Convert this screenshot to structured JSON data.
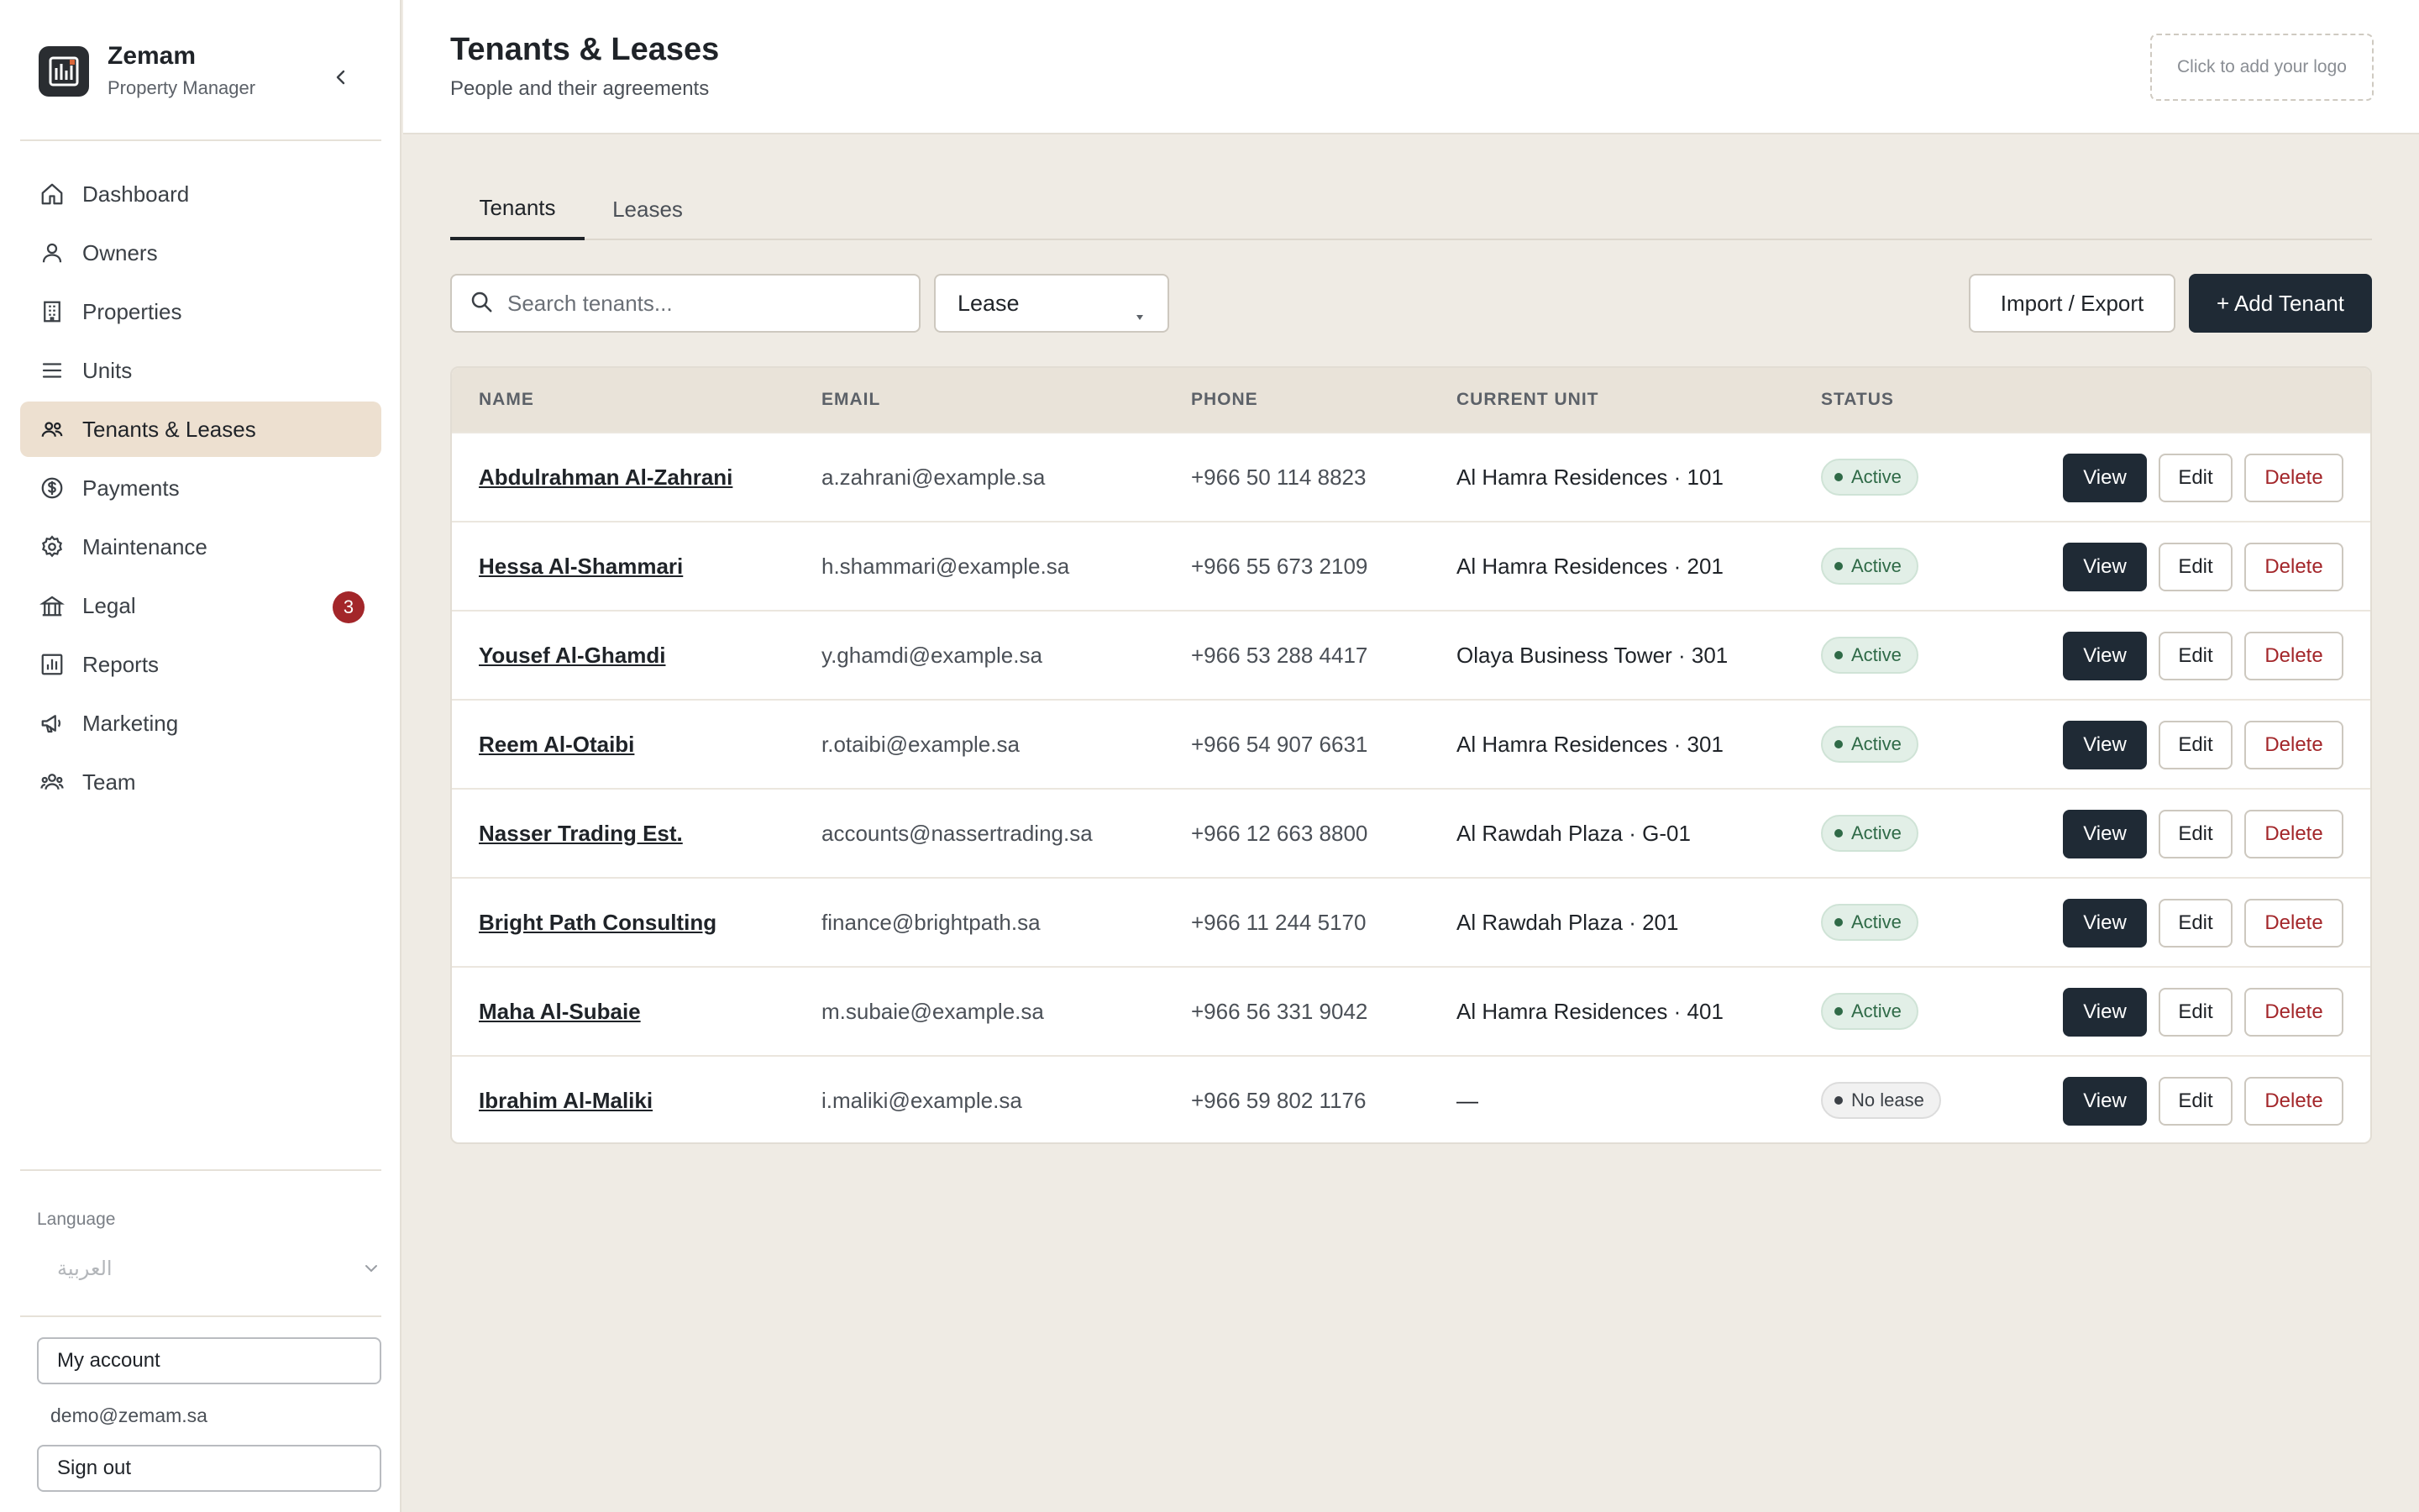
{
  "brand": {
    "name": "Zemam",
    "subtitle": "Property Manager"
  },
  "sidebar": {
    "items": [
      {
        "label": "Dashboard",
        "icon": "home-icon",
        "active": false
      },
      {
        "label": "Owners",
        "icon": "user-icon",
        "active": false
      },
      {
        "label": "Properties",
        "icon": "building-icon",
        "active": false
      },
      {
        "label": "Units",
        "icon": "list-icon",
        "active": false
      },
      {
        "label": "Tenants & Leases",
        "icon": "users-icon",
        "active": true
      },
      {
        "label": "Payments",
        "icon": "dollar-icon",
        "active": false
      },
      {
        "label": "Maintenance",
        "icon": "gear-icon",
        "active": false
      },
      {
        "label": "Legal",
        "icon": "bank-icon",
        "active": false,
        "badge": "3"
      },
      {
        "label": "Reports",
        "icon": "chart-icon",
        "active": false
      },
      {
        "label": "Marketing",
        "icon": "megaphone-icon",
        "active": false
      },
      {
        "label": "Team",
        "icon": "team-icon",
        "active": false
      }
    ],
    "language_label": "Language",
    "language_value": "العربية",
    "account_label": "My account",
    "user_email": "demo@zemam.sa",
    "signout_label": "Sign out"
  },
  "header": {
    "title": "Tenants & Leases",
    "subtitle": "People and their agreements",
    "logo_placeholder": "Click to add your logo"
  },
  "tabs": [
    {
      "label": "Tenants",
      "active": true
    },
    {
      "label": "Leases",
      "active": false
    }
  ],
  "toolbar": {
    "search_placeholder": "Search tenants...",
    "filter_value": "Lease",
    "import_export_label": "Import / Export",
    "add_label": "+ Add Tenant"
  },
  "table": {
    "columns": [
      "NAME",
      "EMAIL",
      "PHONE",
      "CURRENT UNIT",
      "STATUS"
    ],
    "action_labels": {
      "view": "View",
      "edit": "Edit",
      "delete": "Delete"
    },
    "rows": [
      {
        "name": "Abdulrahman Al-Zahrani",
        "email": "a.zahrani@example.sa",
        "phone": "+966 50 114 8823",
        "unit": "Al Hamra Residences · 101",
        "status": "Active",
        "status_type": "active"
      },
      {
        "name": "Hessa Al-Shammari",
        "email": "h.shammari@example.sa",
        "phone": "+966 55 673 2109",
        "unit": "Al Hamra Residences · 201",
        "status": "Active",
        "status_type": "active"
      },
      {
        "name": "Yousef Al-Ghamdi",
        "email": "y.ghamdi@example.sa",
        "phone": "+966 53 288 4417",
        "unit": "Olaya Business Tower · 301",
        "status": "Active",
        "status_type": "active"
      },
      {
        "name": "Reem Al-Otaibi",
        "email": "r.otaibi@example.sa",
        "phone": "+966 54 907 6631",
        "unit": "Al Hamra Residences · 301",
        "status": "Active",
        "status_type": "active"
      },
      {
        "name": "Nasser Trading Est.",
        "email": "accounts@nassertrading.sa",
        "phone": "+966 12 663 8800",
        "unit": "Al Rawdah Plaza · G-01",
        "status": "Active",
        "status_type": "active"
      },
      {
        "name": "Bright Path Consulting",
        "email": "finance@brightpath.sa",
        "phone": "+966 11 244 5170",
        "unit": "Al Rawdah Plaza · 201",
        "status": "Active",
        "status_type": "active"
      },
      {
        "name": "Maha Al-Subaie",
        "email": "m.subaie@example.sa",
        "phone": "+966 56 331 9042",
        "unit": "Al Hamra Residences · 401",
        "status": "Active",
        "status_type": "active"
      },
      {
        "name": "Ibrahim Al-Maliki",
        "email": "i.maliki@example.sa",
        "phone": "+966 59 802 1176",
        "unit": "—",
        "status": "No lease",
        "status_type": "nolease"
      }
    ]
  },
  "colors": {
    "accent_dark": "#1f2a35",
    "active_nav_bg": "#ede0d0",
    "danger": "#a3262a",
    "status_active": "#2f6a47",
    "page_bg": "#efebe4"
  }
}
